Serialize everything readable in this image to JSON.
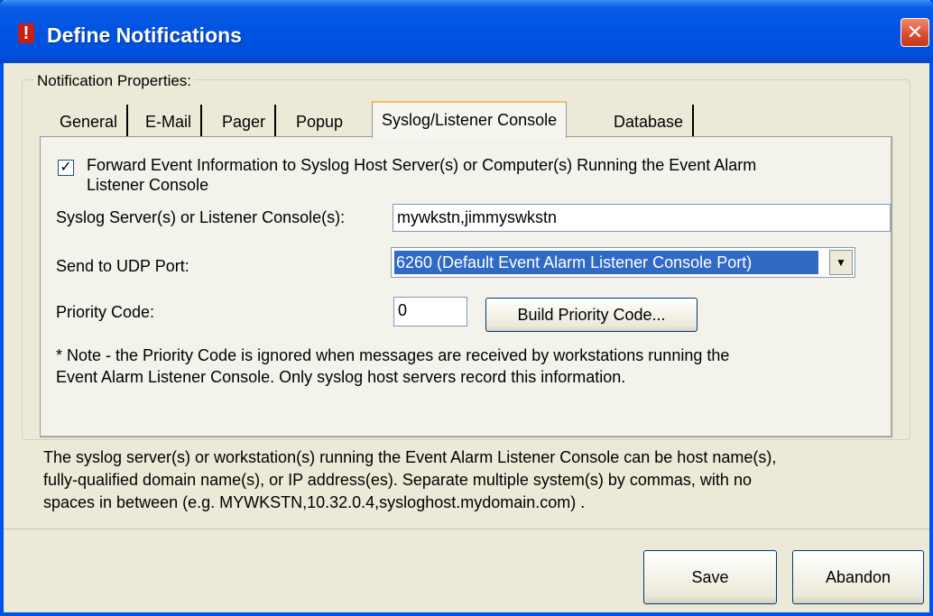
{
  "window": {
    "title": "Define Notifications",
    "close_glyph": "✕",
    "app_icon_glyph": "!"
  },
  "group": {
    "legend": "Notification Properties:"
  },
  "tabs": [
    {
      "label": "General"
    },
    {
      "label": "E-Mail"
    },
    {
      "label": "Pager"
    },
    {
      "label": "Popup"
    },
    {
      "label": "Syslog/Listener Console"
    },
    {
      "label": "Database"
    }
  ],
  "active_tab": "Syslog/Listener Console",
  "syslog": {
    "forward_checked": true,
    "check_glyph": "✓",
    "forward_label_line1": "Forward Event Information to Syslog Host Server(s) or Computer(s) Running the Event Alarm",
    "forward_label_line2": "Listener Console",
    "servers_label": "Syslog Server(s) or Listener Console(s):",
    "servers_value": "mywkstn,jimmyswkstn",
    "udp_label": "Send to UDP Port:",
    "udp_value": "6260 (Default Event Alarm Listener Console Port)",
    "dropdown_glyph": "▼",
    "priority_label": "Priority Code:",
    "priority_value": "0",
    "build_button": "Build Priority Code...",
    "note_line1": "* Note - the Priority Code is ignored when messages are received by workstations running the",
    "note_line2": "Event Alarm Listener Console.  Only syslog host servers record this information."
  },
  "help_text": {
    "line1": "The syslog server(s) or workstation(s) running the Event Alarm Listener Console can be host name(s),",
    "line2": "fully-qualified domain name(s), or IP address(es).  Separate multiple system(s) by commas, with no",
    "line3": "spaces in between (e.g. MYWKSTN,10.32.0.4,sysloghost.mydomain.com) ."
  },
  "actions": {
    "save": "Save",
    "abandon": "Abandon"
  },
  "colors": {
    "titlebar": "#0053e1",
    "dialog_bg": "#ece9d8",
    "selection": "#316ac5",
    "close_button": "#d94a2c"
  }
}
